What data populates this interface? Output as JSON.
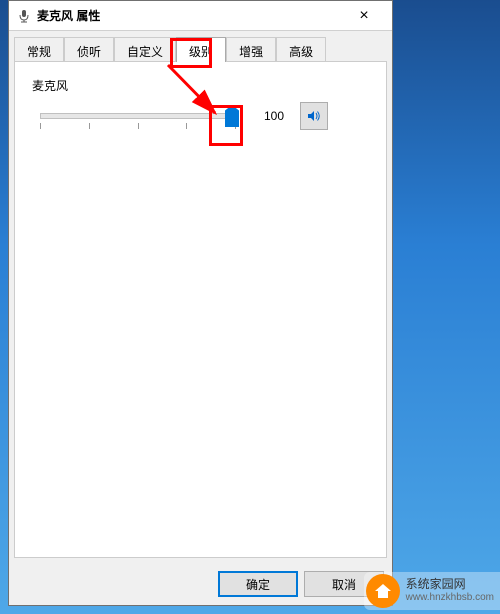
{
  "window": {
    "title": "麦克风 属性",
    "close_label": "×"
  },
  "tabs": [
    {
      "label": "常规"
    },
    {
      "label": "侦听"
    },
    {
      "label": "自定义"
    },
    {
      "label": "级别",
      "active": true
    },
    {
      "label": "增强"
    },
    {
      "label": "高级"
    }
  ],
  "level": {
    "group_label": "麦克风",
    "value": "100",
    "slider_percent": 100
  },
  "buttons": {
    "ok": "确定",
    "cancel": "取消"
  },
  "watermark": {
    "name": "系统家园网",
    "url": "www.hnzkhbsb.com"
  }
}
